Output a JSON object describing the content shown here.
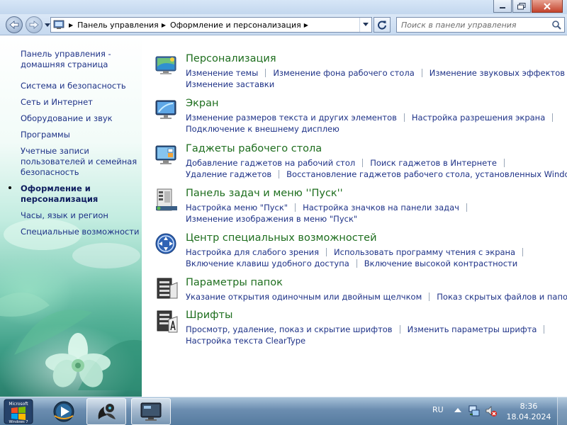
{
  "window": {
    "address": [
      "Панель управления",
      "Оформление и персонализация"
    ],
    "search_placeholder": "Поиск в панели управления"
  },
  "sidebar": {
    "items": [
      {
        "label": "Панель управления - домашняя страница",
        "current": false
      },
      {
        "label": "Система и безопасность",
        "current": false
      },
      {
        "label": "Сеть и Интернет",
        "current": false
      },
      {
        "label": "Оборудование и звук",
        "current": false
      },
      {
        "label": "Программы",
        "current": false
      },
      {
        "label": "Учетные записи пользователей и семейная безопасность",
        "current": false
      },
      {
        "label": "Оформление и персонализация",
        "current": true
      },
      {
        "label": "Часы, язык и регион",
        "current": false
      },
      {
        "label": "Специальные возможности",
        "current": false
      }
    ]
  },
  "categories": [
    {
      "title": "Персонализация",
      "icon": "personalization-icon",
      "rows": [
        [
          "Изменение темы",
          "Изменение фона рабочего стола",
          "Изменение звуковых эффектов"
        ],
        [
          "Изменение заставки"
        ]
      ]
    },
    {
      "title": "Экран",
      "icon": "display-icon",
      "rows": [
        [
          "Изменение размеров текста и других элементов",
          "Настройка разрешения экрана"
        ],
        [
          "Подключение к внешнему дисплею"
        ]
      ]
    },
    {
      "title": "Гаджеты рабочего стола",
      "icon": "gadgets-icon",
      "rows": [
        [
          "Добавление гаджетов на рабочий стол",
          "Поиск гаджетов в Интернете"
        ],
        [
          "Удаление гаджетов",
          "Восстановление гаджетов рабочего стола, установленных Windows"
        ]
      ]
    },
    {
      "title": "Панель задач и меню ''Пуск''",
      "icon": "taskbar-icon",
      "rows": [
        [
          "Настройка меню \"Пуск\"",
          "Настройка значков на панели задач"
        ],
        [
          "Изменение изображения в меню \"Пуск\""
        ]
      ]
    },
    {
      "title": "Центр специальных возможностей",
      "icon": "ease-of-access-icon",
      "rows": [
        [
          "Настройка для слабого зрения",
          "Использовать программу чтения с экрана"
        ],
        [
          "Включение клавиш удобного доступа",
          "Включение высокой контрастности"
        ]
      ]
    },
    {
      "title": "Параметры папок",
      "icon": "folder-options-icon",
      "rows": [
        [
          "Указание открытия одиночным или двойным щелчком",
          "Показ скрытых файлов и папок"
        ]
      ]
    },
    {
      "title": "Шрифты",
      "icon": "fonts-icon",
      "rows": [
        [
          "Просмотр, удаление, показ и скрытие шрифтов",
          "Изменить параметры шрифта"
        ],
        [
          "Настройка текста ClearType"
        ]
      ]
    }
  ],
  "taskbar": {
    "start_label": "Microsoft Windows 7",
    "language": "RU",
    "time": "8:36",
    "date": "18.04.2024"
  }
}
